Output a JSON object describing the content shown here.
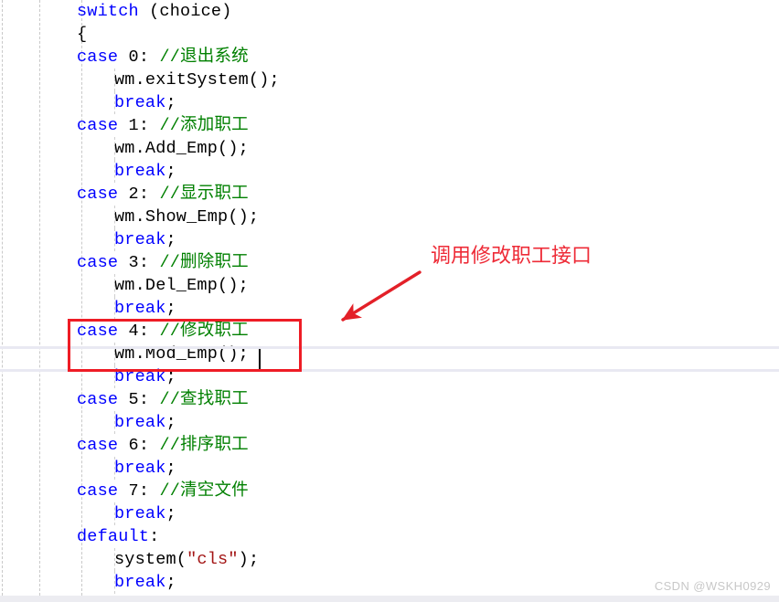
{
  "editor": {
    "language": "cpp",
    "caret_visible": true,
    "colors": {
      "background": "#ffffff",
      "keyword": "#0000ff",
      "comment": "#008000",
      "string": "#a31515",
      "plain_text": "#000000",
      "indent_guide": "#c9c9c9",
      "current_line_rule": "#e9e9f2",
      "annotation_red": "#ee1c25",
      "annotation_text_red": "#ee2b37",
      "watermark": "#c8c8c8",
      "bottom_band": "#ececf1"
    },
    "lines": [
      {
        "indent": 0,
        "tokens": [
          {
            "t": "switch",
            "c": "kw"
          },
          {
            "t": " (choice)",
            "c": "plain"
          }
        ]
      },
      {
        "indent": 0,
        "tokens": [
          {
            "t": "{",
            "c": "plain"
          }
        ]
      },
      {
        "indent": 0,
        "tokens": [
          {
            "t": "case",
            "c": "kw"
          },
          {
            "t": " 0: ",
            "c": "plain"
          },
          {
            "t": "//退出系统",
            "c": "cmt"
          }
        ]
      },
      {
        "indent": 1,
        "tokens": [
          {
            "t": "wm.exitSystem();",
            "c": "plain"
          }
        ]
      },
      {
        "indent": 1,
        "tokens": [
          {
            "t": "break",
            "c": "kw"
          },
          {
            "t": ";",
            "c": "plain"
          }
        ]
      },
      {
        "indent": 0,
        "tokens": [
          {
            "t": "case",
            "c": "kw"
          },
          {
            "t": " 1: ",
            "c": "plain"
          },
          {
            "t": "//添加职工",
            "c": "cmt"
          }
        ]
      },
      {
        "indent": 1,
        "tokens": [
          {
            "t": "wm.Add_Emp();",
            "c": "plain"
          }
        ]
      },
      {
        "indent": 1,
        "tokens": [
          {
            "t": "break",
            "c": "kw"
          },
          {
            "t": ";",
            "c": "plain"
          }
        ]
      },
      {
        "indent": 0,
        "tokens": [
          {
            "t": "case",
            "c": "kw"
          },
          {
            "t": " 2: ",
            "c": "plain"
          },
          {
            "t": "//显示职工",
            "c": "cmt"
          }
        ]
      },
      {
        "indent": 1,
        "tokens": [
          {
            "t": "wm.Show_Emp();",
            "c": "plain"
          }
        ]
      },
      {
        "indent": 1,
        "tokens": [
          {
            "t": "break",
            "c": "kw"
          },
          {
            "t": ";",
            "c": "plain"
          }
        ]
      },
      {
        "indent": 0,
        "tokens": [
          {
            "t": "case",
            "c": "kw"
          },
          {
            "t": " 3: ",
            "c": "plain"
          },
          {
            "t": "//删除职工",
            "c": "cmt"
          }
        ]
      },
      {
        "indent": 1,
        "tokens": [
          {
            "t": "wm.Del_Emp();",
            "c": "plain"
          }
        ]
      },
      {
        "indent": 1,
        "tokens": [
          {
            "t": "break",
            "c": "kw"
          },
          {
            "t": ";",
            "c": "plain"
          }
        ]
      },
      {
        "indent": 0,
        "tokens": [
          {
            "t": "case",
            "c": "kw"
          },
          {
            "t": " 4: ",
            "c": "plain"
          },
          {
            "t": "//修改职工",
            "c": "cmt"
          }
        ]
      },
      {
        "indent": 1,
        "tokens": [
          {
            "t": "wm.Mod_Emp();",
            "c": "plain"
          }
        ]
      },
      {
        "indent": 1,
        "tokens": [
          {
            "t": "break",
            "c": "kw"
          },
          {
            "t": ";",
            "c": "plain"
          }
        ]
      },
      {
        "indent": 0,
        "tokens": [
          {
            "t": "case",
            "c": "kw"
          },
          {
            "t": " 5: ",
            "c": "plain"
          },
          {
            "t": "//查找职工",
            "c": "cmt"
          }
        ]
      },
      {
        "indent": 1,
        "tokens": [
          {
            "t": "break",
            "c": "kw"
          },
          {
            "t": ";",
            "c": "plain"
          }
        ]
      },
      {
        "indent": 0,
        "tokens": [
          {
            "t": "case",
            "c": "kw"
          },
          {
            "t": " 6: ",
            "c": "plain"
          },
          {
            "t": "//排序职工",
            "c": "cmt"
          }
        ]
      },
      {
        "indent": 1,
        "tokens": [
          {
            "t": "break",
            "c": "kw"
          },
          {
            "t": ";",
            "c": "plain"
          }
        ]
      },
      {
        "indent": 0,
        "tokens": [
          {
            "t": "case",
            "c": "kw"
          },
          {
            "t": " 7: ",
            "c": "plain"
          },
          {
            "t": "//清空文件",
            "c": "cmt"
          }
        ]
      },
      {
        "indent": 1,
        "tokens": [
          {
            "t": "break",
            "c": "kw"
          },
          {
            "t": ";",
            "c": "plain"
          }
        ]
      },
      {
        "indent": 0,
        "tokens": [
          {
            "t": "default",
            "c": "kw"
          },
          {
            "t": ":",
            "c": "plain"
          }
        ]
      },
      {
        "indent": 1,
        "tokens": [
          {
            "t": "system(",
            "c": "plain"
          },
          {
            "t": "\"cls\"",
            "c": "str"
          },
          {
            "t": ");",
            "c": "plain"
          }
        ]
      },
      {
        "indent": 1,
        "tokens": [
          {
            "t": "break",
            "c": "kw"
          },
          {
            "t": ";",
            "c": "plain"
          }
        ]
      }
    ]
  },
  "annotations": {
    "callout_text": "调用修改职工接口",
    "highlight_box_target_lines": [
      "case 4: //修改职工",
      "wm.Mod_Emp();"
    ]
  },
  "watermark": {
    "text": "CSDN @WSKH0929"
  }
}
